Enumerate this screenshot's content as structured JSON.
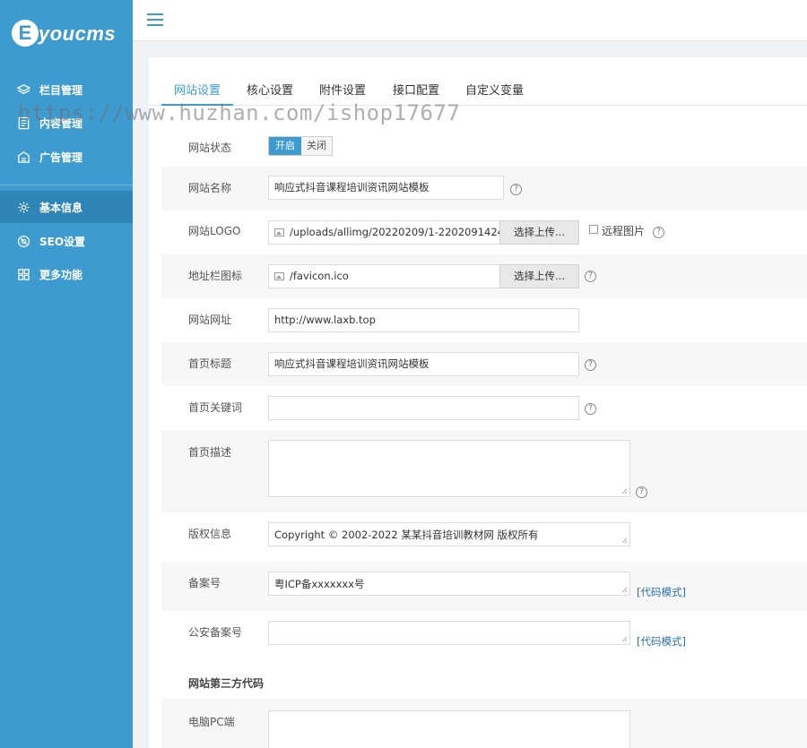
{
  "logo": {
    "letter": "E",
    "text": "youcms"
  },
  "sidebar": {
    "items": [
      {
        "label": "栏目管理",
        "icon": "layers-icon"
      },
      {
        "label": "内容管理",
        "icon": "document-icon"
      },
      {
        "label": "广告管理",
        "icon": "ad-icon"
      },
      {
        "label": "基本信息",
        "icon": "gear-icon"
      },
      {
        "label": "SEO设置",
        "icon": "seo-icon"
      },
      {
        "label": "更多功能",
        "icon": "grid-icon"
      }
    ],
    "active_index": 3
  },
  "tabs": [
    {
      "label": "网站设置",
      "active": true
    },
    {
      "label": "核心设置",
      "active": false
    },
    {
      "label": "附件设置",
      "active": false
    },
    {
      "label": "接口配置",
      "active": false
    },
    {
      "label": "自定义变量",
      "active": false
    }
  ],
  "form": {
    "status": {
      "label": "网站状态",
      "on": "开启",
      "off": "关闭",
      "value": "开启"
    },
    "site_name": {
      "label": "网站名称",
      "value": "响应式抖音课程培训资讯网站模板"
    },
    "logo": {
      "label": "网站LOGO",
      "value": "/uploads/allimg/20220209/1-2202091424",
      "button": "选择上传...",
      "remote_label": "远程图片"
    },
    "favicon": {
      "label": "地址栏图标",
      "value": "/favicon.ico",
      "button": "选择上传..."
    },
    "site_url": {
      "label": "网站网址",
      "value": "http://www.laxb.top"
    },
    "home_title": {
      "label": "首页标题",
      "value": "响应式抖音课程培训资讯网站模板"
    },
    "home_keywords": {
      "label": "首页关键词",
      "value": ""
    },
    "home_desc": {
      "label": "首页描述",
      "value": ""
    },
    "copyright": {
      "label": "版权信息",
      "value": "Copyright © 2002-2022 某某抖音培训教材网 版权所有"
    },
    "icp": {
      "label": "备案号",
      "value": "粤ICP备xxxxxxx号",
      "code_mode": "[代码模式]"
    },
    "police": {
      "label": "公安备案号",
      "value": "",
      "code_mode": "[代码模式]"
    },
    "third_party": {
      "heading": "网站第三方代码"
    },
    "pc_code": {
      "label": "电脑PC端",
      "value": ""
    },
    "help_glyph": "?"
  },
  "watermark": "https://www.huzhan.com/ishop17677",
  "colors": {
    "sidebar": "#3e9bd0",
    "sidebar_active": "#2f85b8",
    "accent": "#3e9bd0",
    "link": "#2a6fb0"
  }
}
